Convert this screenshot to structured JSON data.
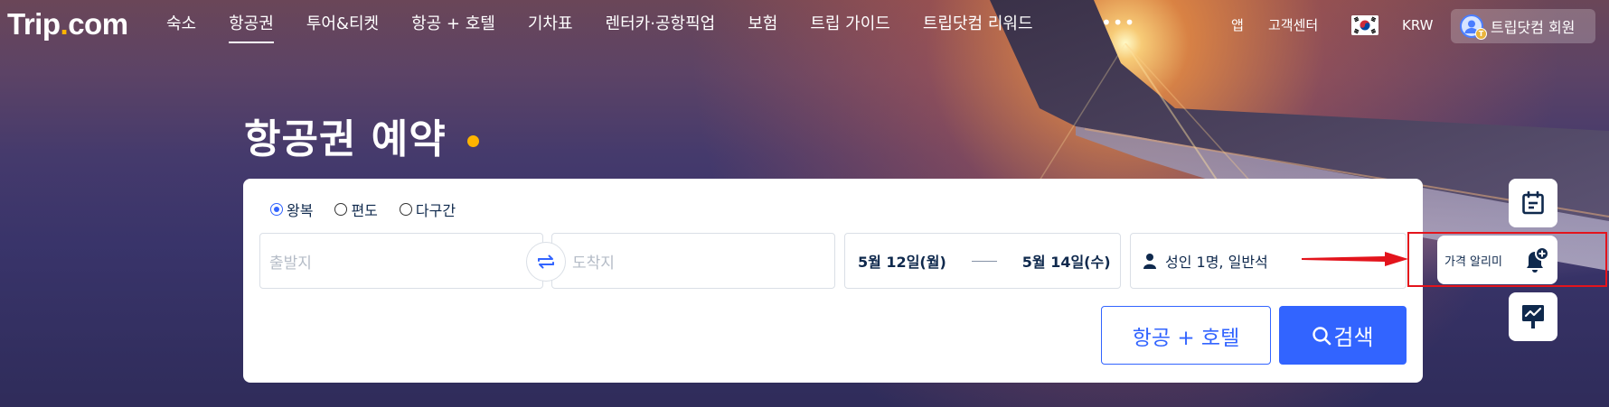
{
  "brand": {
    "logo_text_1": "Trip",
    "logo_dot": ".",
    "logo_text_2": "com"
  },
  "nav": {
    "items": [
      {
        "label": "숙소",
        "active": false
      },
      {
        "label": "항공권",
        "active": true
      },
      {
        "label": "투어&티켓",
        "active": false
      },
      {
        "label": "항공 + 호텔",
        "active": false
      },
      {
        "label": "기차표",
        "active": false
      },
      {
        "label": "렌터카·공항픽업",
        "active": false
      },
      {
        "label": "보험",
        "active": false
      },
      {
        "label": "트립 가이드",
        "active": false
      },
      {
        "label": "트립닷컴 리워드",
        "active": false
      }
    ],
    "more": "•••",
    "app": "앱",
    "support": "고객센터",
    "currency": "KRW",
    "member": "트립닷컴 회원",
    "member_coin": "T"
  },
  "hero": {
    "title": "항공권 예약"
  },
  "search": {
    "trip_types": [
      {
        "label": "왕복",
        "checked": true
      },
      {
        "label": "편도",
        "checked": false
      },
      {
        "label": "다구간",
        "checked": false
      }
    ],
    "origin_placeholder": "출발지",
    "destination_placeholder": "도착지",
    "depart_date": "5월 12일(월)",
    "return_date": "5월 14일(수)",
    "passengers": "성인 1명, 일반석",
    "bundle_button": "항공 + 호텔",
    "search_button": "검색"
  },
  "side": {
    "price_alert": "가격 알리미"
  },
  "colors": {
    "accent": "#3264ff",
    "dot": "#ffb400",
    "highlight": "#e3141c"
  }
}
